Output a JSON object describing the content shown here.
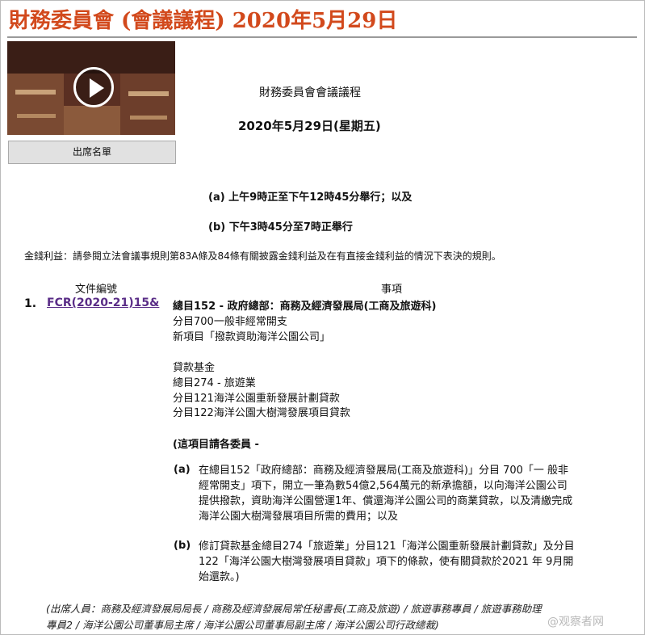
{
  "header": {
    "title": "財務委員會 (會議議程) 2020年5月29日"
  },
  "video": {
    "play_icon": "play-icon"
  },
  "attendance_button": "出席名單",
  "agenda": {
    "title": "財務委員會會議議程",
    "date": "2020年5月29日(星期五)",
    "time_a": "(a) 上午9時正至下午12時45分舉行；以及",
    "time_b": "(b) 下午3時45分至7時正舉行"
  },
  "interest_notice": "金錢利益：請參閱立法會議事規則第83A條及84條有關披露金錢利益及在有直接金錢利益的情況下表決的規則。",
  "columns": {
    "doc": "文件編號",
    "item": "事項"
  },
  "item": {
    "number": "1.",
    "doc_link": "FCR(2020-21)15&",
    "lines_1": [
      "總目152 - 政府總部：商務及經濟發展局(工商及旅遊科)",
      "分目700一般非經常開支",
      "新項目「撥款資助海洋公園公司」"
    ],
    "lines_2": [
      "貸款基金",
      "總目274 - 旅遊業",
      "分目121海洋公園重新發展計劃貸款",
      "分目122海洋公園大樹灣發展項目貸款"
    ],
    "invite": "(這項目請各委員 -",
    "a_label": "(a)",
    "a_lines": [
      "在總目152「政府總部：商務及經濟發展局(工商及旅遊科)」分目 700「一 般非",
      "經常開支」項下，開立一筆為數54億2,564萬元的新承擔額，以向海洋公園公司",
      "提供撥款，資助海洋公園營運1年、償還海洋公園公司的商業貸款，以及清繳完成",
      "海洋公園大樹灣發展項目所需的費用；以及"
    ],
    "b_label": "(b)",
    "b_lines": [
      "修訂貸款基金總目274「旅遊業」分目121「海洋公園重新發展計劃貸款」及分目",
      "122「海洋公園大樹灣發展項目貸款」項下的條款，使有關貸款於2021 年 9月開",
      "始還款。)"
    ]
  },
  "attendees": [
    "(出席人員：商務及經濟發展局局長 / 商務及經濟發展局常任秘書長(工商及旅遊) / 旅遊事務專員 / 旅遊事務助理",
    "專員2 / 海洋公園公司董事局主席 / 海洋公園公司董事局副主席 / 海洋公園公司行政總裁)"
  ],
  "watermark": "@观察者网"
}
